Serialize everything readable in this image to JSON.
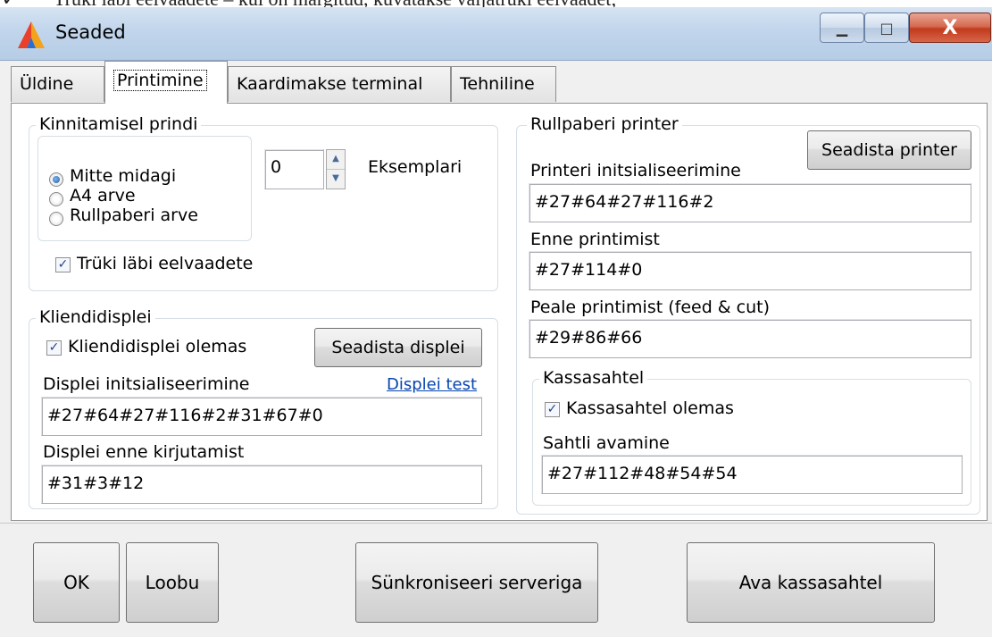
{
  "background_text": "Trüki läbi eelvaadete – kui on märgitud, kuvatakse väljatrüki eelvaadet;",
  "window": {
    "title": "Seaded",
    "minimize_label": "▁",
    "maximize_label": "□",
    "close_label": "X"
  },
  "tabs": [
    {
      "label": "Üldine"
    },
    {
      "label": "Printimine"
    },
    {
      "label": "Kaardimakse terminal"
    },
    {
      "label": "Tehniline"
    }
  ],
  "print_on_confirm": {
    "title": "Kinnitamisel prindi",
    "options": [
      "Mitte midagi",
      "A4 arve",
      "Rullpaberi arve"
    ],
    "selected_index": 0,
    "copies_value": "0",
    "copies_label": "Eksemplari",
    "preview_label": "Trüki läbi eelvaadete",
    "preview_checked": true
  },
  "customer_display": {
    "title": "Kliendidisplei",
    "exists_label": "Kliendidisplei olemas",
    "exists_checked": true,
    "setup_button": "Seadista displei",
    "init_label": "Displei initsialiseerimine",
    "test_link": "Displei test",
    "init_value": "#27#64#27#116#2#31#67#0",
    "before_write_label": "Displei enne kirjutamist",
    "before_write_value": "#31#3#12"
  },
  "roll_printer": {
    "title": "Rullpaberi printer",
    "setup_button": "Seadista printer",
    "init_label": "Printeri initsialiseerimine",
    "init_value": "#27#64#27#116#2",
    "before_print_label": "Enne printimist",
    "before_print_value": "#27#114#0",
    "after_print_label": "Peale printimist (feed & cut)",
    "after_print_value": "#29#86#66"
  },
  "cash_drawer": {
    "title": "Kassasahtel",
    "exists_label": "Kassasahtel olemas",
    "exists_checked": true,
    "open_label": "Sahtli avamine",
    "open_value": "#27#112#48#54#54"
  },
  "footer": {
    "ok": "OK",
    "cancel": "Loobu",
    "sync": "Sünkroniseeri serveriga",
    "open_drawer": "Ava kassasahtel"
  },
  "colors": {
    "titlebar": "#c2d6ec",
    "close_button": "#c23a1c",
    "link": "#0645ad",
    "dialog_bg": "#f0f0f0"
  }
}
